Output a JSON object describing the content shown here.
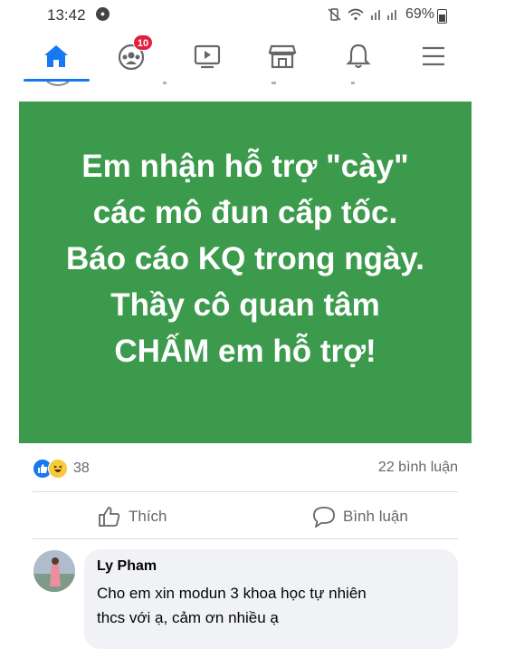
{
  "status_bar": {
    "time": "13:42",
    "battery": "69%",
    "icons": [
      "notification-dot-icon",
      "mute-vibrate-icon",
      "wifi-icon",
      "signal-icon",
      "battery-icon"
    ]
  },
  "nav": {
    "items": [
      {
        "name": "home",
        "icon": "home-icon",
        "active": true
      },
      {
        "name": "groups",
        "icon": "groups-icon",
        "badge": "10"
      },
      {
        "name": "watch",
        "icon": "video-icon"
      },
      {
        "name": "marketplace",
        "icon": "marketplace-icon"
      },
      {
        "name": "notifications",
        "icon": "bell-icon"
      },
      {
        "name": "menu",
        "icon": "hamburger-icon"
      }
    ],
    "accent_color": "#1877f2"
  },
  "post": {
    "background_color": "#3c9a4c",
    "lines": [
      "Em nhận hỗ trợ \"cày\"",
      "các mô đun cấp tốc.",
      "Báo cáo KQ trong ngày.",
      "Thầy cô quan tâm",
      "CHẤM em hỗ trợ!"
    ],
    "reaction_count": "38",
    "reactions": [
      "like-icon",
      "haha-icon"
    ],
    "comment_count": "22 bình luận"
  },
  "actions": {
    "like_label": "Thích",
    "comment_label": "Bình luận"
  },
  "comment": {
    "author": "Ly Pham",
    "text_line1": "Cho em xin modun 3 khoa học tự nhiên",
    "text_line2": "thcs với ạ, cảm ơn nhiều ạ"
  }
}
